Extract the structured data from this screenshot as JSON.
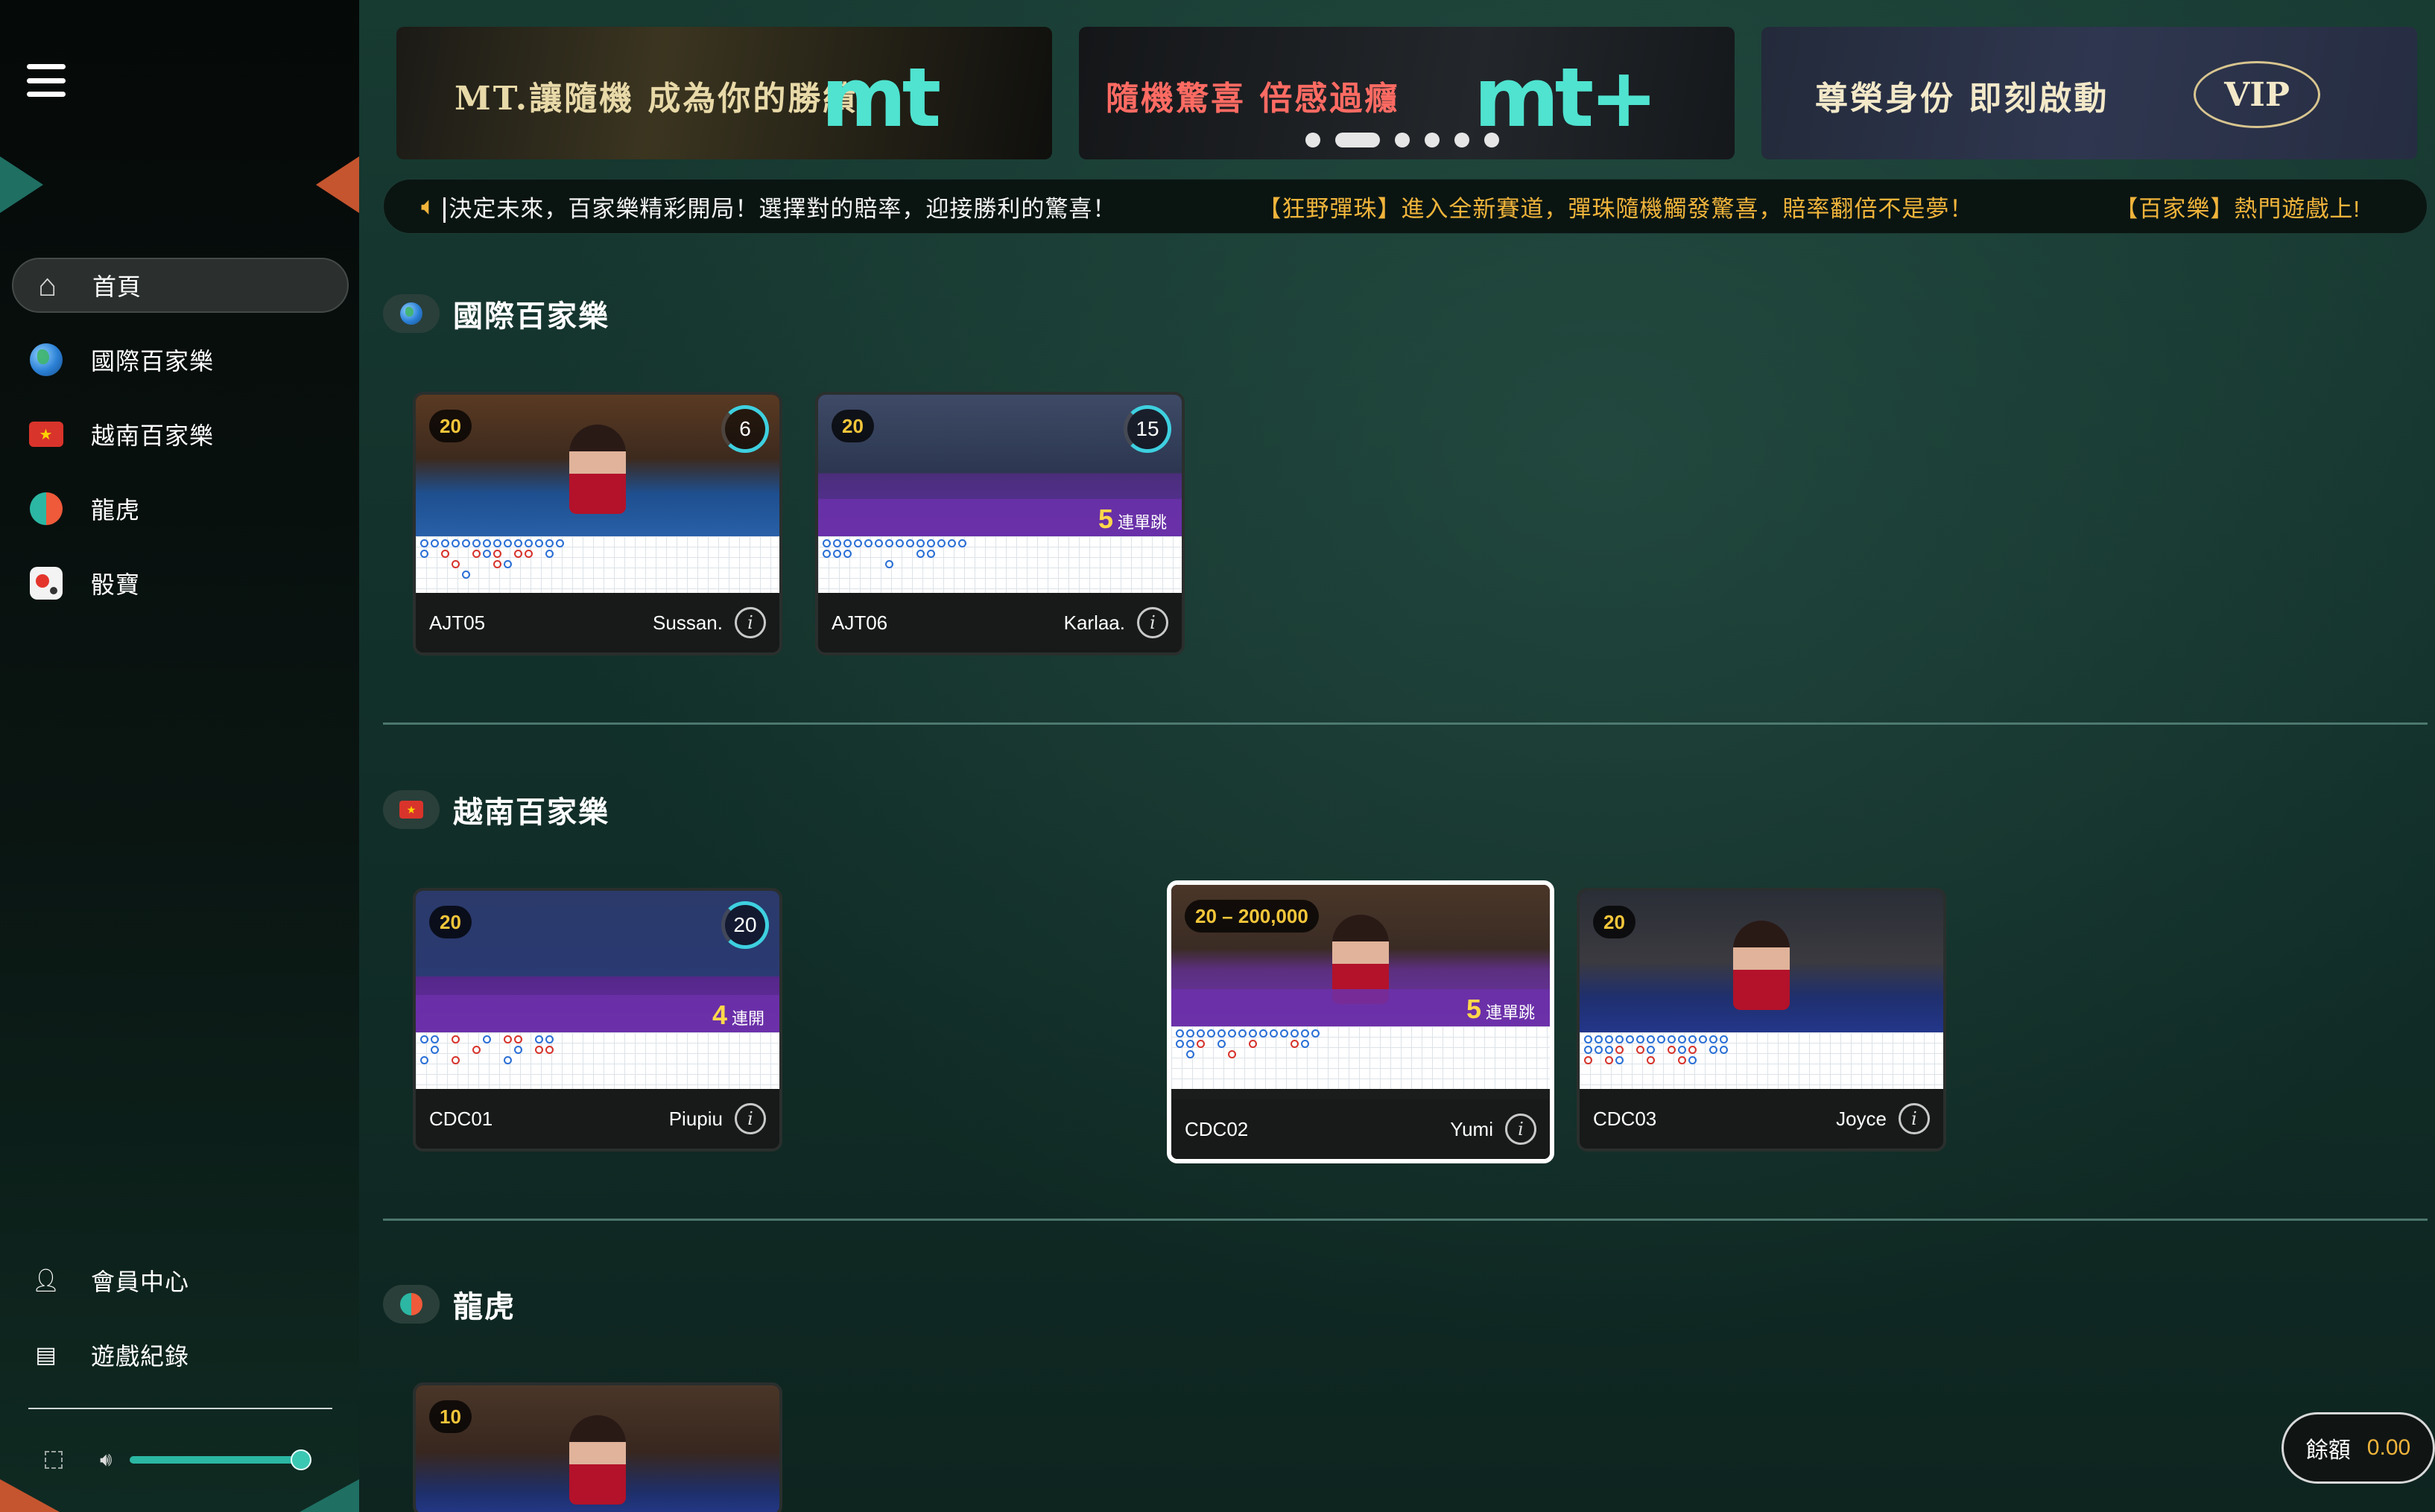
{
  "sidebar": {
    "menu_icon": "hamburger-icon",
    "nav": [
      {
        "label": "首頁",
        "icon": "home-icon"
      },
      {
        "label": "國際百家樂",
        "icon": "globe-icon"
      },
      {
        "label": "越南百家樂",
        "icon": "vietnam-flag-icon"
      },
      {
        "label": "龍虎",
        "icon": "yin-yang-icon"
      },
      {
        "label": "骰寶",
        "icon": "dice-icon"
      }
    ],
    "bottom": [
      {
        "label": "會員中心",
        "icon": "user-icon"
      },
      {
        "label": "遊戲紀錄",
        "icon": "record-icon"
      }
    ],
    "volume_level": 1.0
  },
  "banners": [
    {
      "text": "MT.讓隨機 成為你的勝績",
      "logo": "mt"
    },
    {
      "text": "隨機驚喜 倍感過癮",
      "logo": "mt+"
    },
    {
      "text": "尊榮身份 即刻啟動",
      "badge": "VIP"
    }
  ],
  "carousel": {
    "dots": 6,
    "active_index": 0
  },
  "marquee": {
    "items": [
      "決定未來，百家樂精彩開局！選擇對的賠率，迎接勝利的驚喜！",
      "【狂野彈珠】進入全新賽道，彈珠隨機觸發驚喜，賠率翻倍不是夢！",
      "【百家樂】熱門遊戲上!"
    ]
  },
  "sections": [
    {
      "title": "國際百家樂",
      "icon": "globe-icon",
      "tables": [
        {
          "code": "AJT05",
          "dealer": "Sussan.",
          "limit": "20",
          "timer": "6",
          "strip": null
        },
        {
          "code": "AJT06",
          "dealer": "Karlaa.",
          "limit": "20",
          "timer": "15",
          "strip": {
            "num": "5",
            "text": "連單跳"
          }
        }
      ]
    },
    {
      "title": "越南百家樂",
      "icon": "vietnam-flag-icon",
      "tables": [
        {
          "code": "CDC01",
          "dealer": "Piupiu",
          "limit": "20",
          "timer": "20",
          "strip": {
            "num": "4",
            "text": "連開"
          }
        },
        {
          "code": "CDC02",
          "dealer": "Yumi",
          "limit": "20 – 200,000",
          "timer": null,
          "strip": {
            "num": "5",
            "text": "連單跳"
          }
        },
        {
          "code": "CDC03",
          "dealer": "Joyce",
          "limit": "20",
          "timer": null,
          "strip": null
        }
      ]
    },
    {
      "title": "龍虎",
      "icon": "yin-yang-icon",
      "tables": [
        {
          "code": "",
          "dealer": "",
          "limit": "10",
          "timer": null,
          "strip": null
        }
      ]
    }
  ],
  "balance": {
    "label": "餘額",
    "value": "0.00"
  },
  "colors": {
    "accent_teal": "#2bb7a3",
    "accent_orange": "#c5552f",
    "gold": "#f0b43b",
    "banker_red": "#d7332b",
    "player_blue": "#2a6fd6"
  }
}
